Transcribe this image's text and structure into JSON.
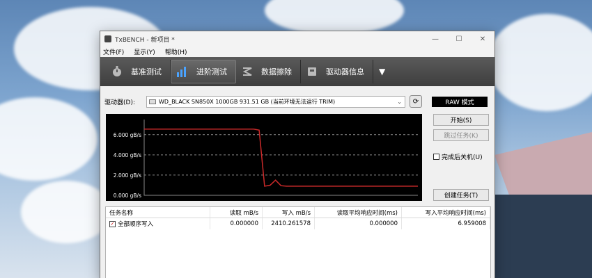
{
  "window": {
    "title": "TxBENCH - 新项目 *",
    "controls": [
      "—",
      "☐",
      "✕"
    ]
  },
  "menu": {
    "items": [
      {
        "label": "文件(F)"
      },
      {
        "label": "显示(Y)"
      },
      {
        "label": "帮助(H)"
      }
    ]
  },
  "tabs": [
    {
      "label": "基准测试",
      "icon": "stopwatch-icon"
    },
    {
      "label": "进阶测试",
      "icon": "bar-chart-icon",
      "active": true
    },
    {
      "label": "数据擦除",
      "icon": "erase-icon"
    },
    {
      "label": "驱动器信息",
      "icon": "drive-info-icon"
    }
  ],
  "drive": {
    "label": "驱动器(D):",
    "selected": "WD_BLACK SN850X 1000GB  931.51 GB (当前环境无法运行 TRIM)",
    "raw_mode": "RAW 模式"
  },
  "actions": {
    "start": "开始(S)",
    "skip": "跳过任务(K)",
    "shutdown": "完成后关机(U)",
    "create_task": "创建任务(T)"
  },
  "chart_data": {
    "type": "line",
    "y_ticks": [
      "6.000 gB/s",
      "4.000 gB/s",
      "2.000 gB/s",
      "0.000 gB/s"
    ],
    "ylim": [
      0,
      7.5
    ],
    "grid": true,
    "series": [
      {
        "color": "#cc2a2a",
        "x": [
          0,
          10,
          20,
          30,
          40,
          42,
          44,
          46,
          48,
          50,
          52,
          55,
          60,
          65,
          70,
          75,
          80,
          85,
          90,
          95,
          100
        ],
        "values": [
          6.55,
          6.55,
          6.55,
          6.55,
          6.55,
          6.45,
          0.9,
          1.0,
          1.5,
          0.95,
          0.9,
          0.9,
          0.9,
          0.9,
          0.9,
          0.9,
          0.9,
          0.9,
          0.9,
          0.9,
          0.9
        ]
      }
    ]
  },
  "table": {
    "headers": [
      "任务名称",
      "读取 mB/s",
      "写入 mB/s",
      "读取平均响应时间(ms)",
      "写入平均响应时间(ms)"
    ],
    "rows": [
      {
        "name": "全部顺序写入",
        "read": "0.000000",
        "write": "2410.261578",
        "read_lat": "0.000000",
        "write_lat": "6.959008"
      }
    ]
  }
}
